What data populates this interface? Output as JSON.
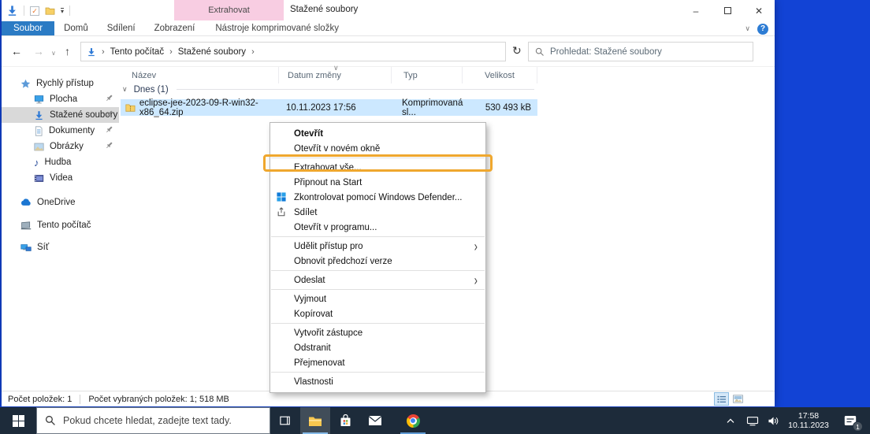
{
  "window": {
    "title": "Stažené soubory",
    "context_group_label": "Extrahovat",
    "tabs": [
      {
        "label": "Soubor"
      },
      {
        "label": "Domů"
      },
      {
        "label": "Sdílení"
      },
      {
        "label": "Zobrazení"
      },
      {
        "label": "Nástroje komprimované složky"
      }
    ]
  },
  "icons": {
    "back": "←",
    "forward": "→",
    "up": "↑",
    "refresh": "↻",
    "chevron_down": "∨",
    "crumb_sep": "›",
    "submenu_arrow": "›",
    "minimize": "–",
    "close": "✕",
    "help": "?",
    "music_note": "♪"
  },
  "address": {
    "crumbs": [
      "Tento počítač",
      "Stažené soubory"
    ],
    "search_placeholder": "Prohledat: Stažené soubory"
  },
  "sidebar": {
    "items": [
      {
        "label": "Rychlý přístup"
      },
      {
        "label": "Plocha"
      },
      {
        "label": "Stažené soubory"
      },
      {
        "label": "Dokumenty"
      },
      {
        "label": "Obrázky"
      },
      {
        "label": "Hudba"
      },
      {
        "label": "Videa"
      },
      {
        "label": "OneDrive"
      },
      {
        "label": "Tento počítač"
      },
      {
        "label": "Síť"
      }
    ]
  },
  "list": {
    "columns": [
      "Název",
      "Datum změny",
      "Typ",
      "Velikost"
    ],
    "group_label": "Dnes (1)",
    "rows": [
      {
        "name": "eclipse-jee-2023-09-R-win32-x86_64.zip",
        "modified": "10.11.2023 17:56",
        "type": "Komprimovaná sl...",
        "size": "530 493 kB"
      }
    ]
  },
  "menu": {
    "items": [
      {
        "label": "Otevřít"
      },
      {
        "label": "Otevřít v novém okně"
      },
      {
        "label": "Extrahovat vše..."
      },
      {
        "label": "Připnout na Start"
      },
      {
        "label": "Zkontrolovat pomocí Windows Defender..."
      },
      {
        "label": "Sdílet"
      },
      {
        "label": "Otevřít v programu..."
      },
      {
        "label": "Udělit přístup pro"
      },
      {
        "label": "Obnovit předchozí verze"
      },
      {
        "label": "Odeslat"
      },
      {
        "label": "Vyjmout"
      },
      {
        "label": "Kopírovat"
      },
      {
        "label": "Vytvořit zástupce"
      },
      {
        "label": "Odstranit"
      },
      {
        "label": "Přejmenovat"
      },
      {
        "label": "Vlastnosti"
      }
    ]
  },
  "status": {
    "count": "Počet položek: 1",
    "selection": "Počet vybraných položek: 1; 518 MB"
  },
  "taskbar": {
    "search_placeholder": "Pokud chcete hledat, zadejte text tady.",
    "time": "17:58",
    "date": "10.11.2023",
    "notification_badge": "1"
  },
  "colors": {
    "desktop": "#1243d5",
    "taskbar": "#1d2b3a",
    "file_tab_blue": "#2b7bc4",
    "context_tab_pink": "#f8cde2",
    "selection_blue": "#cce8ff",
    "annotation_orange": "#efa72e",
    "sidebar_selected": "#d9d9d9"
  }
}
